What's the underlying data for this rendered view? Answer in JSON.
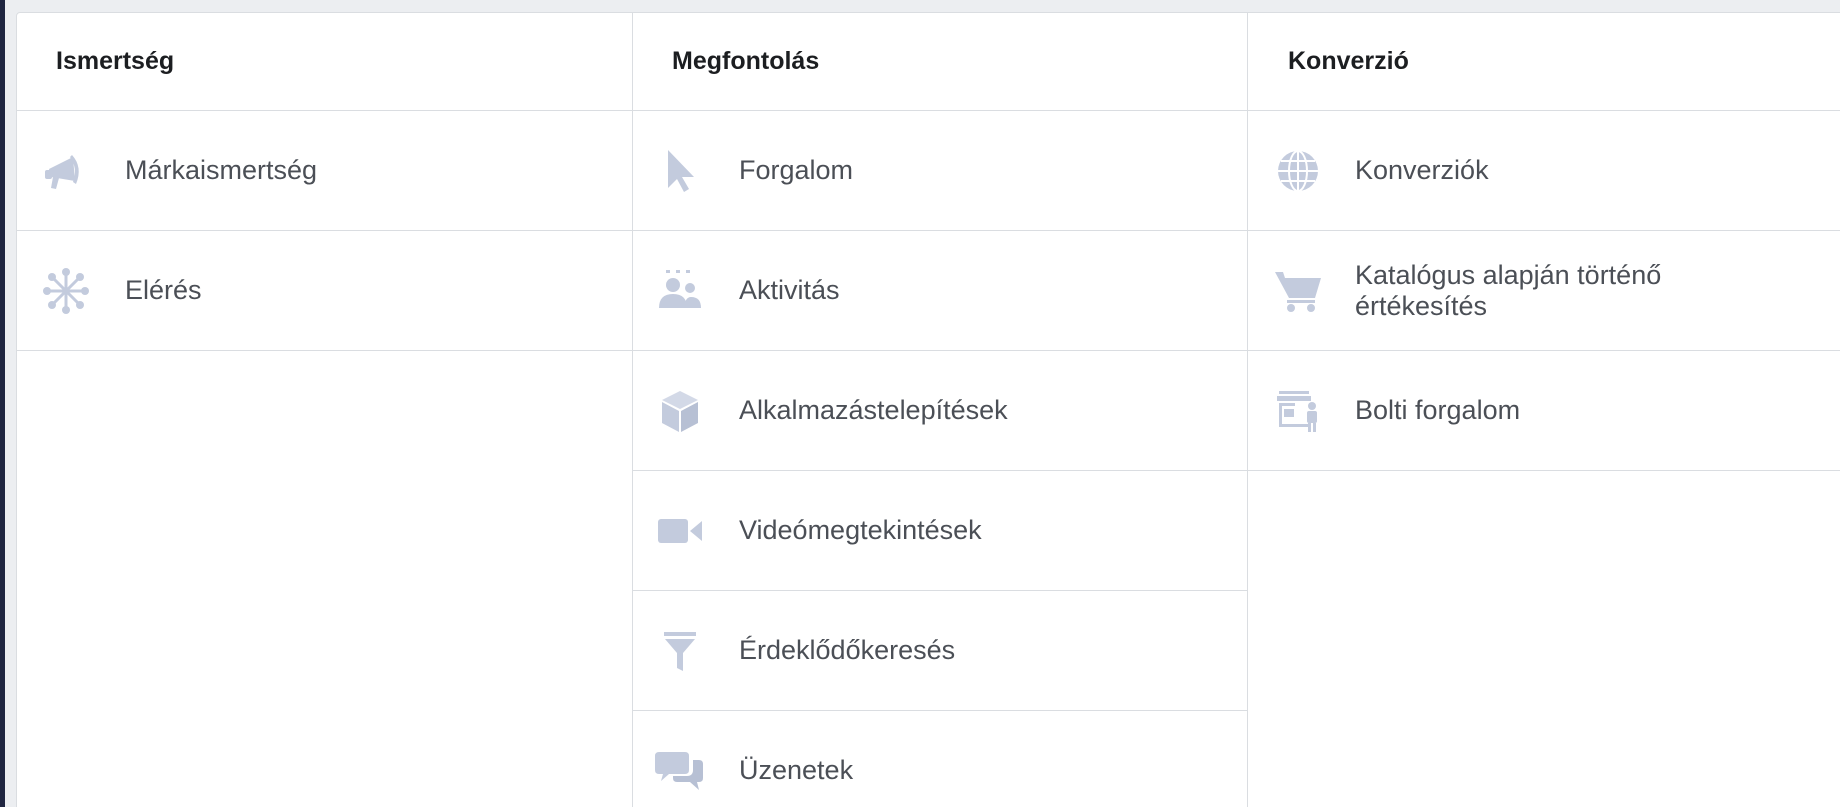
{
  "colors": {
    "icon": "#c3cbdd",
    "text": "#4b4f56",
    "header_text": "#1c1e21",
    "divider": "#dadde1"
  },
  "columns": [
    {
      "title": "Ismertség",
      "items": [
        {
          "label": "Márkaismertség",
          "icon": "megaphone-icon"
        },
        {
          "label": "Elérés",
          "icon": "reach-network-icon"
        }
      ]
    },
    {
      "title": "Megfontolás",
      "items": [
        {
          "label": "Forgalom",
          "icon": "cursor-icon"
        },
        {
          "label": "Aktivitás",
          "icon": "people-icon"
        },
        {
          "label": "Alkalmazástelepítések",
          "icon": "cube-icon"
        },
        {
          "label": "Videómegtekintések",
          "icon": "video-camera-icon"
        },
        {
          "label": "Érdeklődőkeresés",
          "icon": "funnel-icon"
        },
        {
          "label": "Üzenetek",
          "icon": "chat-bubbles-icon"
        }
      ]
    },
    {
      "title": "Konverzió",
      "items": [
        {
          "label": "Konverziók",
          "icon": "globe-icon"
        },
        {
          "label": "Katalógus alapján történő\nértékesítés",
          "icon": "shopping-cart-icon"
        },
        {
          "label": "Bolti forgalom",
          "icon": "store-icon"
        }
      ]
    }
  ]
}
